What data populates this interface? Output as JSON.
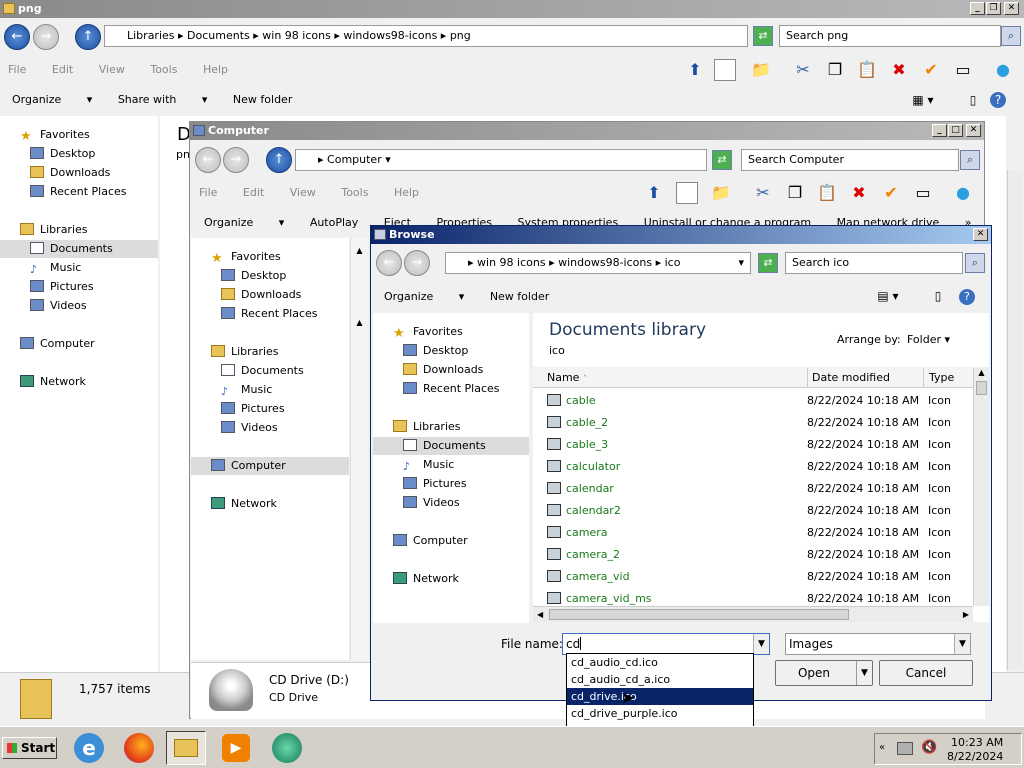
{
  "main_window": {
    "title": "png",
    "address": [
      "Libraries",
      "Documents",
      "win 98 icons",
      "windows98-icons",
      "png"
    ],
    "search_placeholder": "Search png",
    "menu": [
      "File",
      "Edit",
      "View",
      "Tools",
      "Help"
    ],
    "commands": [
      "Organize",
      "Share with",
      "New folder"
    ],
    "nav": [
      "Favorites",
      "Desktop",
      "Downloads",
      "Recent Places",
      "Libraries",
      "Documents",
      "Music",
      "Pictures",
      "Videos",
      "Computer",
      "Network"
    ],
    "status_count": "1,757 items",
    "content_letter": "D",
    "content_sub": "pn"
  },
  "computer_window": {
    "title": "Computer",
    "address": "Computer",
    "search_placeholder": "Search Computer",
    "menu": [
      "File",
      "Edit",
      "View",
      "Tools",
      "Help"
    ],
    "commands": [
      "Organize",
      "AutoPlay",
      "Eject",
      "Properties",
      "System properties",
      "Uninstall or change a program",
      "Map network drive",
      "»"
    ],
    "nav": [
      "Favorites",
      "Desktop",
      "Downloads",
      "Recent Places",
      "Libraries",
      "Documents",
      "Music",
      "Pictures",
      "Videos",
      "Computer",
      "Network"
    ],
    "drive_name": "CD Drive (D:)",
    "drive_type": "CD Drive"
  },
  "browse_dialog": {
    "title": "Browse",
    "address": [
      "win 98 icons",
      "windows98-icons",
      "ico"
    ],
    "search_placeholder": "Search ico",
    "commands": [
      "Organize",
      "New folder"
    ],
    "nav": [
      "Favorites",
      "Desktop",
      "Downloads",
      "Recent Places",
      "Libraries",
      "Documents",
      "Music",
      "Pictures",
      "Videos",
      "Computer",
      "Network"
    ],
    "library_title": "Documents library",
    "library_sub": "ico",
    "arrange_label": "Arrange by:",
    "arrange_value": "Folder",
    "columns": [
      "Name",
      "Date modified",
      "Type"
    ],
    "files": [
      {
        "name": "cable",
        "date": "8/22/2024 10:18 AM",
        "type": "Icon"
      },
      {
        "name": "cable_2",
        "date": "8/22/2024 10:18 AM",
        "type": "Icon"
      },
      {
        "name": "cable_3",
        "date": "8/22/2024 10:18 AM",
        "type": "Icon"
      },
      {
        "name": "calculator",
        "date": "8/22/2024 10:18 AM",
        "type": "Icon"
      },
      {
        "name": "calendar",
        "date": "8/22/2024 10:18 AM",
        "type": "Icon"
      },
      {
        "name": "calendar2",
        "date": "8/22/2024 10:18 AM",
        "type": "Icon"
      },
      {
        "name": "camera",
        "date": "8/22/2024 10:18 AM",
        "type": "Icon"
      },
      {
        "name": "camera_2",
        "date": "8/22/2024 10:18 AM",
        "type": "Icon"
      },
      {
        "name": "camera_vid",
        "date": "8/22/2024 10:18 AM",
        "type": "Icon"
      },
      {
        "name": "camera_vid_ms",
        "date": "8/22/2024 10:18 AM",
        "type": "Icon"
      }
    ],
    "file_name_label": "File name:",
    "file_name_value": "cd",
    "filter_value": "Images",
    "open_label": "Open",
    "cancel_label": "Cancel",
    "suggestions": [
      "cd_audio_cd.ico",
      "cd_audio_cd_a.ico",
      "cd_drive.ico",
      "cd_drive_purple.ico"
    ],
    "highlighted_suggestion": "cd_drive.ico"
  },
  "taskbar": {
    "start_label": "Start",
    "time": "10:23 AM",
    "date": "8/22/2024"
  },
  "colors": {
    "active_title": "#0a246a",
    "inactive_title": "#8a8a8a",
    "file_name_green": "#1a7a1a",
    "highlight": "#0a246a"
  }
}
